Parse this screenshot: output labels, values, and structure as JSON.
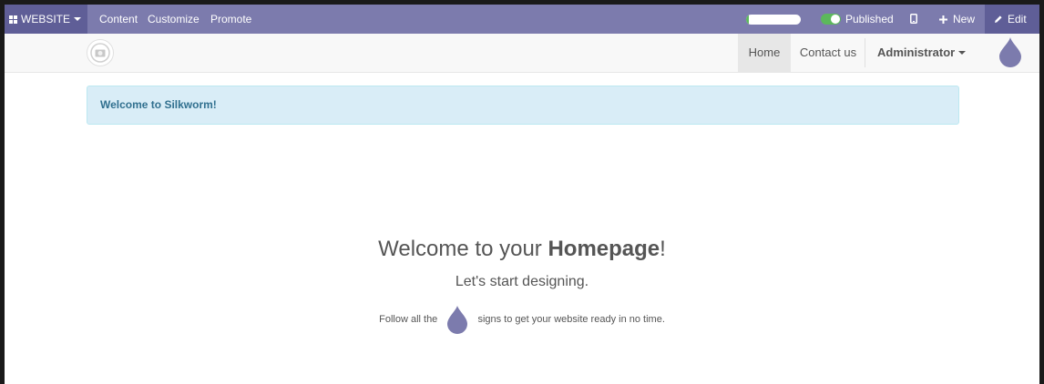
{
  "adminbar": {
    "website_label": "WEBSITE",
    "menu": [
      "Content",
      "Customize",
      "Promote"
    ],
    "progress_fraction": 0.05,
    "published_label": "Published",
    "new_label": "New",
    "edit_label": "Edit",
    "icons": {
      "grid": "grid-icon",
      "mobile": "mobile-icon",
      "plus": "plus-icon",
      "pencil": "pencil-icon"
    }
  },
  "sitenav": {
    "home": "Home",
    "contact": "Contact us",
    "user": "Administrator"
  },
  "alert": {
    "text": "Welcome to Silkworm!"
  },
  "hero": {
    "title_prefix": "Welcome to your ",
    "title_bold": "Homepage",
    "title_suffix": "!",
    "subtitle": "Let's start designing.",
    "follow_before": "Follow all the",
    "follow_after": "signs to get your website ready in no time."
  },
  "colors": {
    "bar": "#7c7bad",
    "drop": "#7c7bad",
    "alert_bg": "#d9edf7",
    "alert_text": "#31708f"
  }
}
